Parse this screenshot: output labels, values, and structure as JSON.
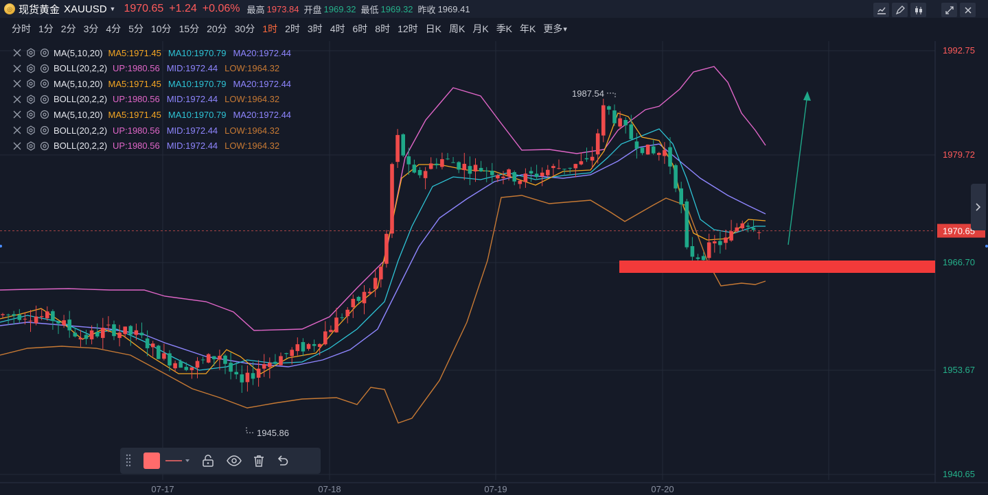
{
  "header": {
    "name": "现货黄金",
    "symbol": "XAUUSD",
    "price": "1970.65",
    "change": "+1.24",
    "change_pct": "+0.06%",
    "high_label": "最高",
    "high_value": "1973.84",
    "open_label": "开盘",
    "open_value": "1969.32",
    "low_label": "最低",
    "low_value": "1969.32",
    "prev_label": "昨收",
    "prev_value": "1969.41"
  },
  "periods": [
    "分时",
    "1分",
    "2分",
    "3分",
    "4分",
    "5分",
    "10分",
    "15分",
    "20分",
    "30分",
    "1时",
    "2时",
    "3时",
    "4时",
    "6时",
    "8时",
    "12时",
    "日K",
    "周K",
    "月K",
    "季K",
    "年K",
    "更多"
  ],
  "active_period": "1时",
  "indicators": [
    {
      "name": "MA(5,10,20)",
      "values": [
        {
          "t": "MA5:1971.45",
          "c": "#f5a623"
        },
        {
          "t": "MA10:1970.79",
          "c": "#2ec4d6"
        },
        {
          "t": "MA20:1972.44",
          "c": "#8f86ff"
        }
      ]
    },
    {
      "name": "BOLL(20,2,2)",
      "values": [
        {
          "t": "UP:1980.56",
          "c": "#e066c8"
        },
        {
          "t": "MID:1972.44",
          "c": "#8f86ff"
        },
        {
          "t": "LOW:1964.32",
          "c": "#c87a34"
        }
      ]
    },
    {
      "name": "MA(5,10,20)",
      "values": [
        {
          "t": "MA5:1971.45",
          "c": "#f5a623"
        },
        {
          "t": "MA10:1970.79",
          "c": "#2ec4d6"
        },
        {
          "t": "MA20:1972.44",
          "c": "#8f86ff"
        }
      ]
    },
    {
      "name": "BOLL(20,2,2)",
      "values": [
        {
          "t": "UP:1980.56",
          "c": "#e066c8"
        },
        {
          "t": "MID:1972.44",
          "c": "#8f86ff"
        },
        {
          "t": "LOW:1964.32",
          "c": "#c87a34"
        }
      ]
    },
    {
      "name": "MA(5,10,20)",
      "values": [
        {
          "t": "MA5:1971.45",
          "c": "#f5a623"
        },
        {
          "t": "MA10:1970.79",
          "c": "#2ec4d6"
        },
        {
          "t": "MA20:1972.44",
          "c": "#8f86ff"
        }
      ]
    },
    {
      "name": "BOLL(20,2,2)",
      "values": [
        {
          "t": "UP:1980.56",
          "c": "#e066c8"
        },
        {
          "t": "MID:1972.44",
          "c": "#8f86ff"
        },
        {
          "t": "LOW:1964.32",
          "c": "#c87a34"
        }
      ]
    },
    {
      "name": "BOLL(20,2,2)",
      "values": [
        {
          "t": "UP:1980.56",
          "c": "#e066c8"
        },
        {
          "t": "MID:1972.44",
          "c": "#8f86ff"
        },
        {
          "t": "LOW:1964.32",
          "c": "#c87a34"
        }
      ]
    }
  ],
  "chart_data": {
    "type": "candlestick",
    "y_axis_ticks": [
      "1992.75",
      "1979.72",
      "1966.70",
      "1953.67",
      "1940.65"
    ],
    "y_axis_tick_colors": [
      "#ff5b5b",
      "#ff5b5b",
      "#25b08a",
      "#25b08a",
      "#25b08a"
    ],
    "ylim": [
      1940.65,
      1992.75
    ],
    "x_axis_ticks": [
      "07-17",
      "07-18",
      "07-19",
      "07-20"
    ],
    "current_price_label": "1970.65",
    "annotations": {
      "high": "1987.54",
      "low": "1945.86"
    },
    "colors": {
      "up": "#ef4b4b",
      "down": "#1fa889",
      "ma5": "#f5a623",
      "ma10": "#2ec4d6",
      "ma20": "#8f86ff",
      "boll_up": "#e066c8",
      "boll_low": "#c87a34",
      "drawing_line": "#f23a3a",
      "drawing_arrow": "#1fa889"
    }
  },
  "drawing_toolbar": {
    "color": "#ff6b6b"
  }
}
